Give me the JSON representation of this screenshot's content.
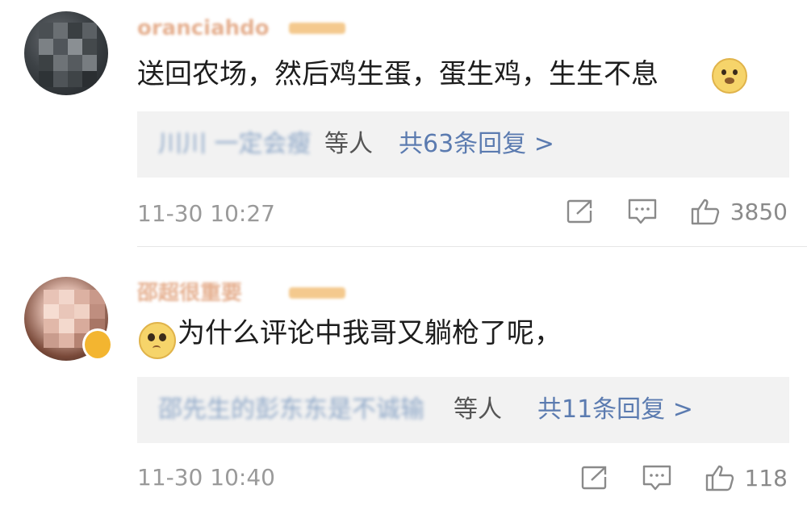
{
  "comments": [
    {
      "username": "oranciahdo",
      "text": "送回农场，然后鸡生蛋，蛋生鸡，生生不息",
      "emoji": "doge-emoji",
      "reply_names": "川川 一定会瘦",
      "reply_suffix": "等人",
      "reply_count": "共63条回复 >",
      "time": "11-30 10:27",
      "likes": "3850"
    },
    {
      "username": "邵超很重要",
      "text": "为什么评论中我哥又躺枪了呢，",
      "emoji": "pleading-emoji",
      "reply_names": "邵先生的彭东东是不诚输",
      "reply_suffix": "等人",
      "reply_count": "共11条回复 >",
      "time": "11-30 10:40",
      "likes": "118"
    }
  ],
  "icons": {
    "repost": "repost-icon",
    "comment": "comment-icon",
    "like": "thumbs-up-icon"
  },
  "colors": {
    "link": "#5b7bb0",
    "meta": "#9a9a9a",
    "reply_bg": "#f2f2f2"
  }
}
